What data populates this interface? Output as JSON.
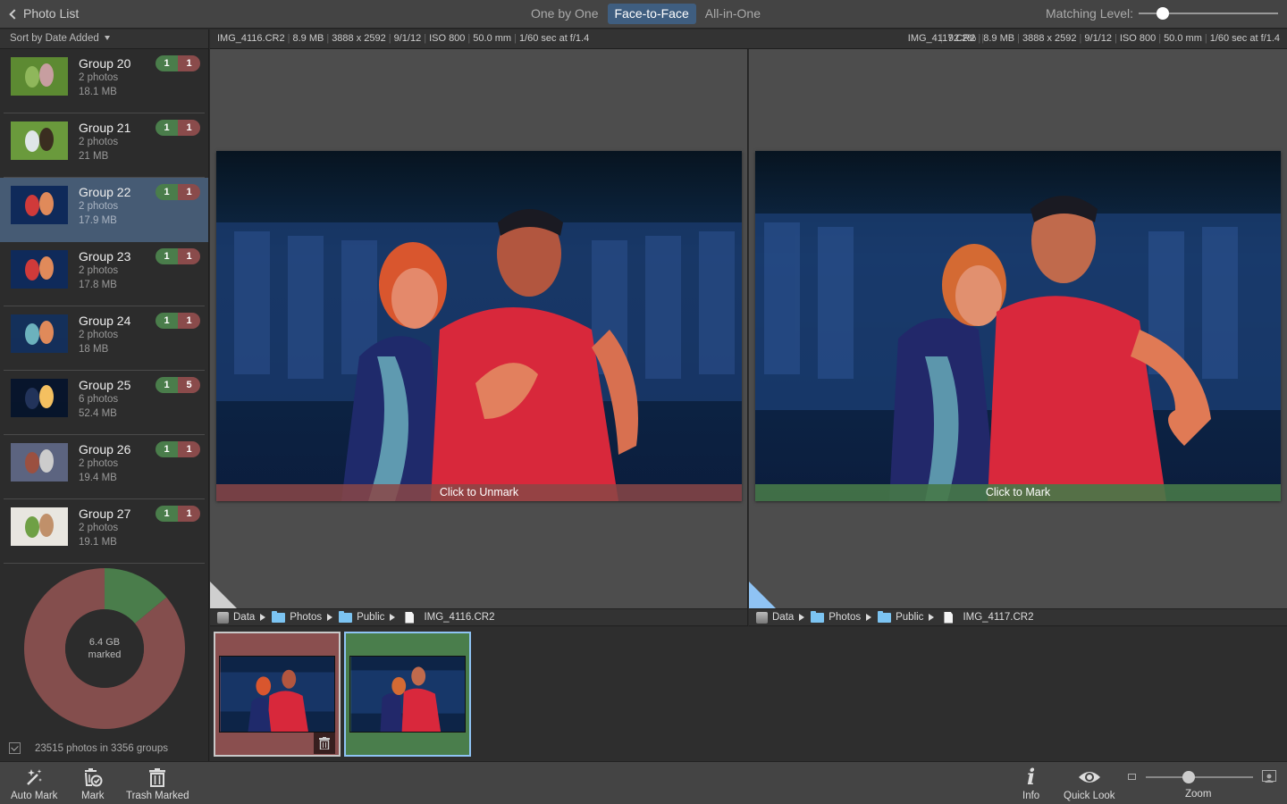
{
  "topbar": {
    "back_label": "Photo List",
    "tabs": [
      {
        "label": "One by One",
        "active": false
      },
      {
        "label": "Face-to-Face",
        "active": true
      },
      {
        "label": "All-in-One",
        "active": false
      }
    ],
    "matching_label": "Matching Level:",
    "matching_level": 0.17
  },
  "sidebar": {
    "sort_label": "Sort by Date Added",
    "groups": [
      {
        "name": "Group 20",
        "count": "2 photos",
        "size": "18.1 MB",
        "keep": "1",
        "marked": "1",
        "selected": false,
        "thumb": "grass"
      },
      {
        "name": "Group 21",
        "count": "2 photos",
        "size": "21 MB",
        "keep": "1",
        "marked": "1",
        "selected": false,
        "thumb": "dog"
      },
      {
        "name": "Group 22",
        "count": "2 photos",
        "size": "17.9 MB",
        "keep": "1",
        "marked": "1",
        "selected": true,
        "thumb": "couple"
      },
      {
        "name": "Group 23",
        "count": "2 photos",
        "size": "17.8 MB",
        "keep": "1",
        "marked": "1",
        "selected": false,
        "thumb": "couple"
      },
      {
        "name": "Group 24",
        "count": "2 photos",
        "size": "18 MB",
        "keep": "1",
        "marked": "1",
        "selected": false,
        "thumb": "couple2"
      },
      {
        "name": "Group 25",
        "count": "6 photos",
        "size": "52.4 MB",
        "keep": "1",
        "marked": "5",
        "selected": false,
        "thumb": "fire"
      },
      {
        "name": "Group 26",
        "count": "2 photos",
        "size": "19.4 MB",
        "keep": "1",
        "marked": "1",
        "selected": false,
        "thumb": "table"
      },
      {
        "name": "Group 27",
        "count": "2 photos",
        "size": "19.1 MB",
        "keep": "1",
        "marked": "1",
        "selected": false,
        "thumb": "girl"
      }
    ],
    "donut": {
      "label_line1": "6.4 GB",
      "label_line2": "marked",
      "keep_fraction": 0.14,
      "keep_color": "#4a7d4b",
      "marked_color": "#844e4d"
    },
    "stats": "23515 photos in 3356 groups"
  },
  "infobar": {
    "left": [
      "IMG_4116.CR2",
      "8.9 MB",
      "3888 x 2592",
      "9/1/12",
      "ISO 800",
      "50.0 mm",
      "1/60 sec at f/1.4"
    ],
    "zoom": "92.2%",
    "right": [
      "IMG_4117.CR2",
      "8.9 MB",
      "3888 x 2592",
      "9/1/12",
      "ISO 800",
      "50.0 mm",
      "1/60 sec at f/1.4"
    ]
  },
  "panes": {
    "left": {
      "action": "Click to Unmark",
      "state": "marked"
    },
    "right": {
      "action": "Click to Mark",
      "state": "kept"
    }
  },
  "paths": {
    "left": [
      "Data",
      "Photos",
      "Public",
      "IMG_4116.CR2"
    ],
    "right": [
      "Data",
      "Photos",
      "Public",
      "IMG_4117.CR2"
    ]
  },
  "bottombar": {
    "auto_mark": "Auto Mark",
    "mark": "Mark",
    "trash_marked": "Trash Marked",
    "info": "Info",
    "quick_look": "Quick Look",
    "zoom": "Zoom",
    "zoom_level": 0.4
  },
  "colors": {
    "accent": "#3f5e80",
    "keep": "#4a7d4b",
    "marked": "#8a4b4b",
    "selection_border": "#8fc3f4"
  }
}
